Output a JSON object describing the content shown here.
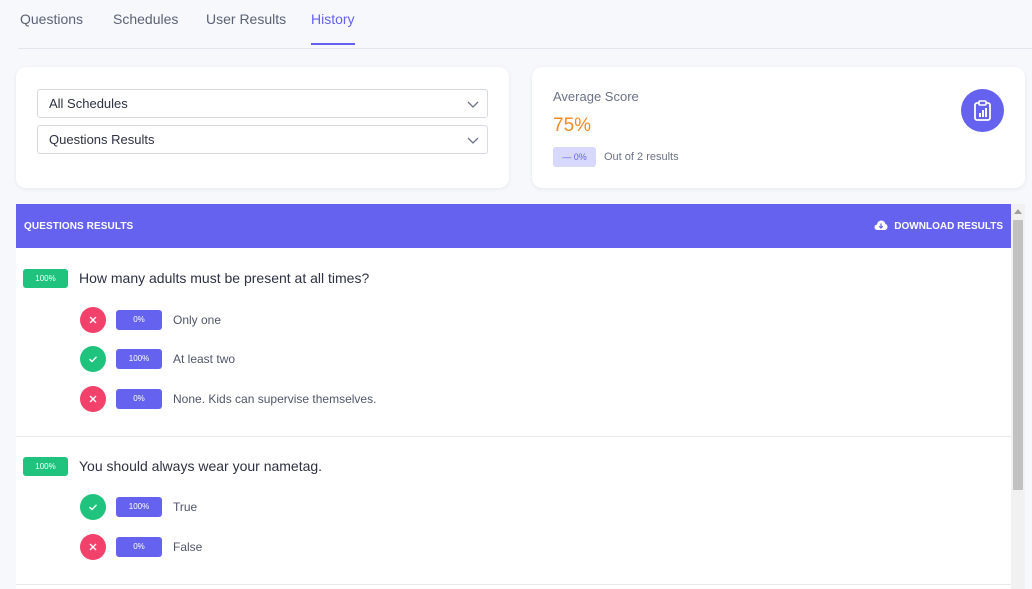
{
  "tabs": [
    {
      "label": "Questions"
    },
    {
      "label": "Schedules"
    },
    {
      "label": "User Results"
    },
    {
      "label": "History"
    }
  ],
  "active_tab": "History",
  "filters": {
    "schedule_select": "All Schedules",
    "results_select": "Questions Results"
  },
  "score": {
    "title": "Average Score",
    "value": "75%",
    "change_badge": "— 0%",
    "subtitle": "Out of 2 results",
    "icon": "clipboard-chart-icon"
  },
  "results": {
    "title": "QUESTIONS RESULTS",
    "download_label": "DOWNLOAD RESULTS",
    "download_icon": "cloud-download-icon",
    "questions": [
      {
        "badge": "100%",
        "text": "How many adults must be present at all times?",
        "answers": [
          {
            "status": "wrong",
            "percent": "0%",
            "text": "Only one"
          },
          {
            "status": "right",
            "percent": "100%",
            "text": "At least two"
          },
          {
            "status": "wrong",
            "percent": "0%",
            "text": "None. Kids can supervise themselves."
          }
        ]
      },
      {
        "badge": "100%",
        "text": "You should always wear your nametag.",
        "answers": [
          {
            "status": "right",
            "percent": "100%",
            "text": "True"
          },
          {
            "status": "wrong",
            "percent": "0%",
            "text": "False"
          }
        ]
      }
    ]
  },
  "colors": {
    "accent": "#6562f0",
    "success": "#20c37d",
    "danger": "#f2416b",
    "score": "#f08a24"
  }
}
